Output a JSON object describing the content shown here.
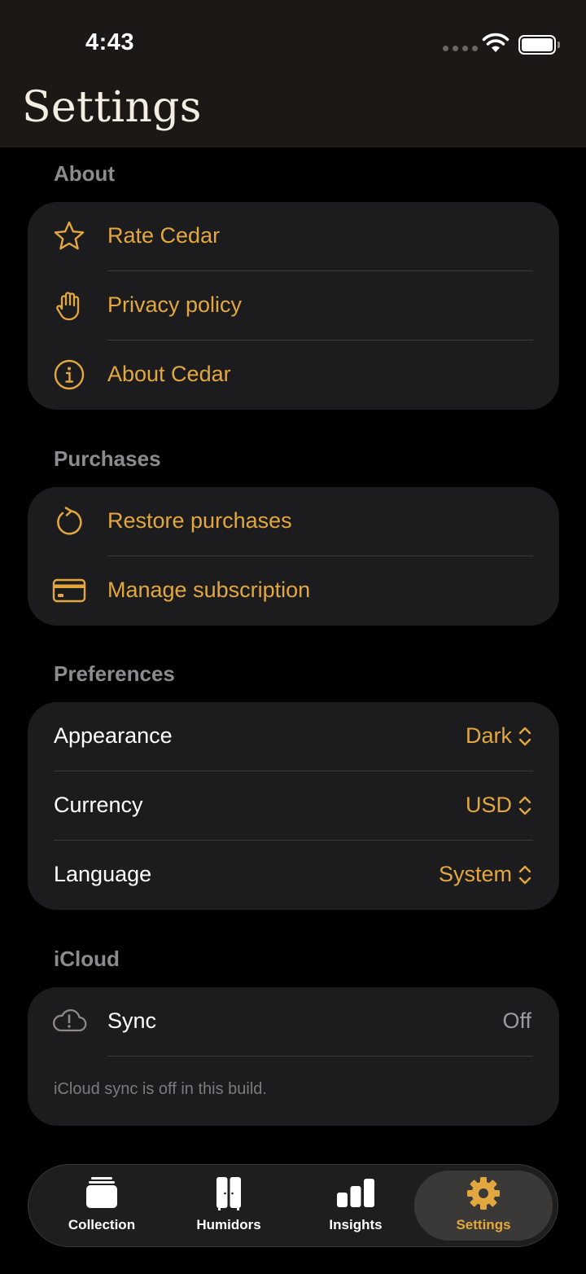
{
  "status_bar": {
    "time": "4:43"
  },
  "header": {
    "title": "Settings"
  },
  "sections": {
    "about": {
      "title": "About",
      "items": [
        {
          "label": "Rate Cedar",
          "icon": "star-icon"
        },
        {
          "label": "Privacy policy",
          "icon": "hand-icon"
        },
        {
          "label": "About Cedar",
          "icon": "info-icon"
        }
      ]
    },
    "purchases": {
      "title": "Purchases",
      "items": [
        {
          "label": "Restore purchases",
          "icon": "refresh-icon"
        },
        {
          "label": "Manage subscription",
          "icon": "credit-card-icon"
        }
      ]
    },
    "preferences": {
      "title": "Preferences",
      "items": [
        {
          "label": "Appearance",
          "value": "Dark"
        },
        {
          "label": "Currency",
          "value": "USD"
        },
        {
          "label": "Language",
          "value": "System"
        }
      ]
    },
    "icloud": {
      "title": "iCloud",
      "sync_label": "Sync",
      "sync_value": "Off",
      "footnote": "iCloud sync is off in this build."
    }
  },
  "tab_bar": {
    "tabs": [
      {
        "label": "Collection",
        "icon": "collection-icon"
      },
      {
        "label": "Humidors",
        "icon": "humidor-icon"
      },
      {
        "label": "Insights",
        "icon": "bar-chart-icon"
      },
      {
        "label": "Settings",
        "icon": "gear-icon",
        "active": true
      }
    ]
  },
  "colors": {
    "accent": "#e2a83f",
    "background": "#000000",
    "card": "#1c1c1e",
    "header_bg": "#1c1816",
    "secondary_text": "#8c8c90"
  }
}
